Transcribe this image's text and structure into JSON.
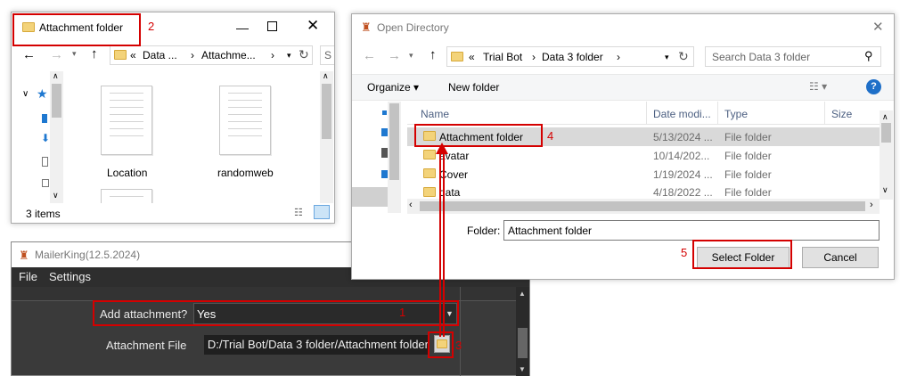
{
  "explorer": {
    "title": "Attachment folder",
    "address_parts": [
      "«",
      "Data ...",
      "›",
      "Attachme...",
      "›"
    ],
    "search_stub": "S",
    "files": [
      {
        "name": "Location"
      },
      {
        "name": "randomweb"
      }
    ],
    "status": "3 items"
  },
  "dialog": {
    "title": "Open Directory",
    "address_parts": [
      "«",
      "Trial Bot",
      "›",
      "Data 3 folder",
      "›"
    ],
    "search_placeholder": "Search Data 3 folder",
    "organize_label": "Organize ▾",
    "new_folder_label": "New folder",
    "columns": [
      "Name",
      "Date modi...",
      "Type",
      "Size"
    ],
    "rows": [
      {
        "name": "Attachment folder",
        "date": "5/13/2024 ...",
        "type": "File folder"
      },
      {
        "name": "avatar",
        "date": "10/14/202...",
        "type": "File folder"
      },
      {
        "name": "Cover",
        "date": "1/19/2024 ...",
        "type": "File folder"
      },
      {
        "name": "data",
        "date": "4/18/2022 ...",
        "type": "File folder"
      }
    ],
    "folder_label": "Folder:",
    "folder_value": "Attachment folder",
    "select_label": "Select Folder",
    "cancel_label": "Cancel"
  },
  "mailer": {
    "title": "MailerKing(12.5.2024)",
    "menu": [
      "File",
      "Settings"
    ],
    "add_attachment_label": "Add attachment?",
    "add_attachment_value": "Yes",
    "attachment_file_label": "Attachment File",
    "attachment_file_value": "D:/Trial Bot/Data 3 folder/Attachment folder"
  },
  "annotations": [
    "1",
    "2",
    "3",
    "4",
    "5"
  ],
  "colors": {
    "annotation": "#d40000",
    "selected_row": "#d9d9d9",
    "dark_bg": "#3a3a3a"
  }
}
